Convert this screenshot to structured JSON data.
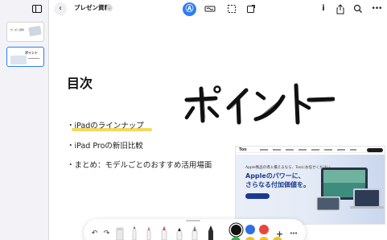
{
  "header": {
    "doc_title": "プレゼン資料",
    "back_icon": "chevron-left-icon",
    "title_menu_icon": "chevron-down-icon",
    "tools": [
      "pen-tool-icon",
      "shape-recognition-icon",
      "lasso-select-icon",
      "sticky-note-icon"
    ],
    "right_icons": [
      "info-icon",
      "share-icon",
      "search-icon",
      "more-icon"
    ]
  },
  "sidebar": {
    "toggle_icon": "sidebar-toggle-icon",
    "pages": [
      {
        "thumb_text": "プレゼン資料"
      },
      {
        "thumb_text": "ポイント"
      }
    ]
  },
  "page": {
    "toc_title": "目次",
    "bullets": [
      "・iPadのラインナップ",
      "・iPad Proの新旧比較",
      "・まとめ：モデルごとのおすすめ活用場面"
    ],
    "handwritten_art": "ポイント"
  },
  "web_screenshot": {
    "logo": "Too",
    "subtitle": "Apple製品の導入備えるなら、Tooにお任せください",
    "headline_1": "Appleのパワーに、",
    "headline_2": "さらなる付加価値を。"
  },
  "draw_toolbar": {
    "icons": [
      "undo-icon",
      "redo-icon",
      "eraser-icon",
      "pen-red-icon",
      "pencil-icon",
      "marker-icon",
      "brush-icon",
      "fountain-pen-icon",
      "add-icon",
      "more-icon"
    ],
    "colors": [
      "#111111",
      "#2f6fe4",
      "#e8453c",
      "#33b54a",
      "#f2c21b",
      "#f2c21b",
      "#f2c21b"
    ],
    "accent": "#2e7cf6",
    "highlight": "#f4d54e"
  }
}
